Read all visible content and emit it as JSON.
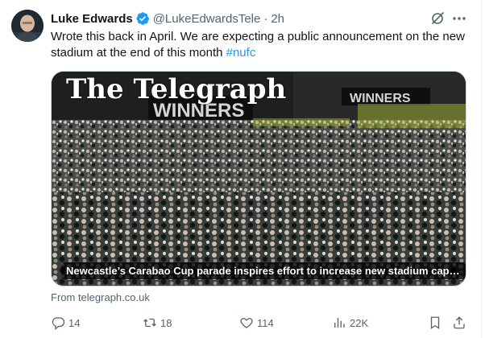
{
  "tweet": {
    "author_name": "Luke Edwards",
    "handle": "@LukeEdwardsTele",
    "separator": "·",
    "time": "2h",
    "text_main": "Wrote this back in April. We are expecting a public announcement on the new stadium at the end of this month ",
    "hashtag": "#nufc"
  },
  "card": {
    "publisher_logo": "The Telegraph",
    "headline": "Newcastle’s Carabao Cup parade inspires effort to increase new stadium capa...",
    "banner_text": "WINNERS",
    "source": "From telegraph.co.uk"
  },
  "actions": {
    "replies": "14",
    "reposts": "18",
    "likes": "114",
    "views": "22K"
  },
  "icons": {
    "verified": "verified-badge-icon",
    "grok": "grok-icon",
    "more": "more-icon",
    "reply": "reply-icon",
    "repost": "repost-icon",
    "like": "like-icon",
    "views": "views-icon",
    "bookmark": "bookmark-icon",
    "share": "share-icon"
  },
  "colors": {
    "text": "#0f1419",
    "secondary": "#536471",
    "accent": "#1d9bf0"
  }
}
